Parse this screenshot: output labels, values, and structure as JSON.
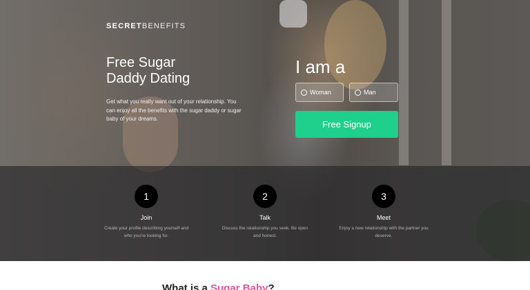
{
  "brand": {
    "logo_bold": "SECRET",
    "logo_thin": "BENEFITS"
  },
  "hero": {
    "headline_line1": "Free Sugar",
    "headline_line2": "Daddy Dating",
    "description": "Get what you really want out of your relationship. You can enjoy all the benefits with the sugar daddy or sugar baby of your dreams."
  },
  "signup_form": {
    "prompt": "I am a",
    "options": [
      {
        "label": "Woman"
      },
      {
        "label": "Man"
      }
    ],
    "submit_label": "Free Signup"
  },
  "steps": [
    {
      "number": "1",
      "title": "Join",
      "description": "Create your profile describing yourself and who you're looking for."
    },
    {
      "number": "2",
      "title": "Talk",
      "description": "Discuss the relationship you seek. Be open and honest."
    },
    {
      "number": "3",
      "title": "Meet",
      "description": "Enjoy a new relationship with the partner you deserve."
    }
  ],
  "section_heading": {
    "prefix": "What is a ",
    "highlight": "Sugar Baby",
    "suffix": "?"
  },
  "colors": {
    "signup_button": "#1fcf8c",
    "highlight_pink": "#e0579a"
  }
}
